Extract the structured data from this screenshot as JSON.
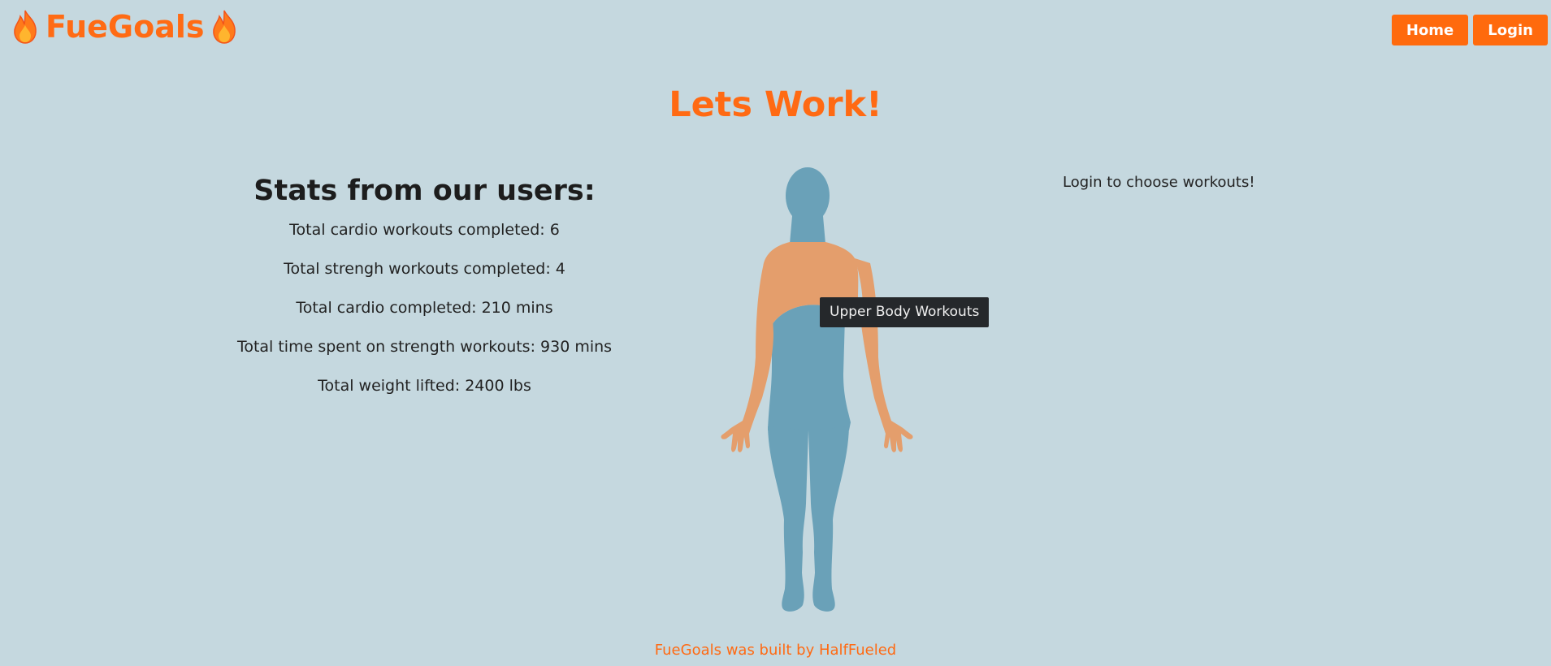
{
  "brand": {
    "name": "FueGoals",
    "left_icon": "flame-icon",
    "right_icon": "flame-icon"
  },
  "nav": {
    "home_label": "Home",
    "login_label": "Login"
  },
  "page": {
    "title": "Lets Work!"
  },
  "stats": {
    "heading": "Stats from our users:",
    "items": [
      "Total cardio workouts completed: 6",
      "Total strengh workouts completed: 4",
      "Total cardio completed: 210 mins",
      "Total time spent on strength workouts: 930 mins",
      "Total weight lifted: 2400 lbs"
    ]
  },
  "body_map": {
    "tooltip": "Upper Body Workouts",
    "highlighted_region": "upper-body"
  },
  "sidebar": {
    "login_message": "Login to choose workouts!"
  },
  "footer": {
    "text": "FueGoals was built by HalfFueled"
  },
  "colors": {
    "background": "#c5d8df",
    "accent": "#ff6a13",
    "body_base": "#6aa1b8",
    "body_highlight": "#e49e6c",
    "tooltip_bg": "#25282b"
  }
}
